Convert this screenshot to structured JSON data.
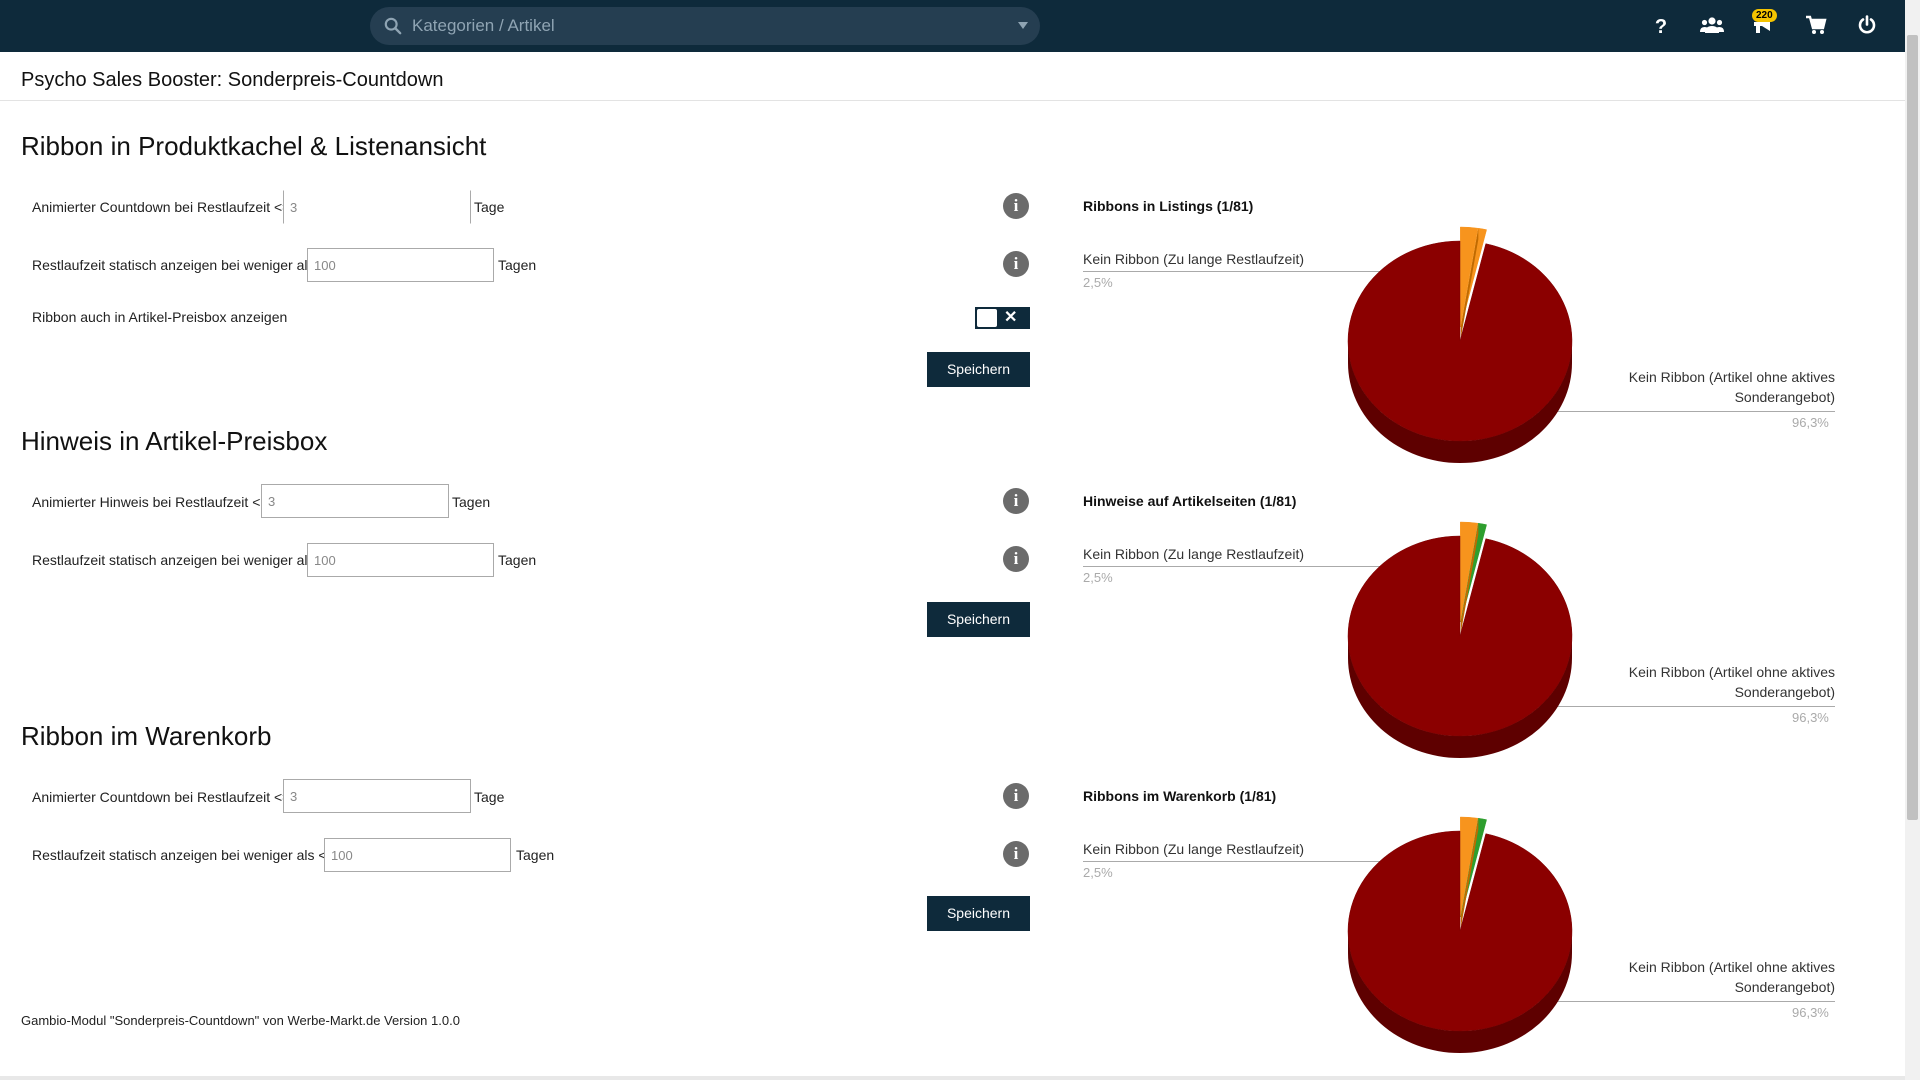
{
  "topbar": {
    "search_placeholder": "Kategorien / Artikel",
    "help_icon": "question-icon",
    "users_icon": "users-icon",
    "notifications_icon": "megaphone-icon",
    "notifications_count": "220",
    "cart_icon": "cart-icon",
    "power_icon": "power-icon"
  },
  "page": {
    "title": "Psycho Sales Booster: Sonderpreis-Countdown"
  },
  "sections": [
    {
      "title": "Ribbon in Produktkachel & Listenansicht",
      "row1_label": "Animierter Countdown bei Restlaufzeit <=",
      "row1_value": "3",
      "row1_unit": "Tage",
      "row2_label": "Restlaufzeit statisch anzeigen bei weniger als",
      "row2_value": "100",
      "row2_unit": "Tagen",
      "toggle_label": "Ribbon auch in Artikel-Preisbox anzeigen",
      "toggle_state": "off",
      "save": "Speichern"
    },
    {
      "title": "Hinweis in Artikel-Preisbox",
      "row1_label": "Animierter Hinweis bei Restlaufzeit <=",
      "row1_value": "3",
      "row1_unit": "Tagen",
      "row2_label": "Restlaufzeit statisch anzeigen bei weniger als",
      "row2_value": "100",
      "row2_unit": "Tagen",
      "save": "Speichern"
    },
    {
      "title": "Ribbon im Warenkorb",
      "row1_label": "Animierter Countdown bei Restlaufzeit <=",
      "row1_value": "3",
      "row1_unit": "Tage",
      "row2_label": "Restlaufzeit statisch anzeigen bei weniger als <=",
      "row2_value": "100",
      "row2_unit": "Tagen",
      "save": "Speichern"
    }
  ],
  "chart_data": [
    {
      "type": "pie",
      "title": "Ribbons in Listings (1/81)",
      "slices": [
        {
          "label": "Kein Ribbon (Zu lange Restlaufzeit)",
          "pct_text": "2,5%",
          "value": 2.5,
          "color": "#f7941d"
        },
        {
          "label": "",
          "pct_text": "",
          "value": 1.2,
          "color": "#f7941d"
        },
        {
          "label": "Kein Ribbon (Artikel ohne aktives Sonderangebot)",
          "pct_text": "96,3%",
          "value": 96.3,
          "color": "#8b0000"
        }
      ]
    },
    {
      "type": "pie",
      "title": "Hinweise auf Artikelseiten (1/81)",
      "slices": [
        {
          "label": "Kein Ribbon (Zu lange Restlaufzeit)",
          "pct_text": "2,5%",
          "value": 2.5,
          "color": "#f7941d"
        },
        {
          "label": "",
          "pct_text": "",
          "value": 1.2,
          "color": "#2e9e2e"
        },
        {
          "label": "Kein Ribbon (Artikel ohne aktives Sonderangebot)",
          "pct_text": "96,3%",
          "value": 96.3,
          "color": "#8b0000"
        }
      ]
    },
    {
      "type": "pie",
      "title": "Ribbons im Warenkorb (1/81)",
      "slices": [
        {
          "label": "Kein Ribbon (Zu lange Restlaufzeit)",
          "pct_text": "2,5%",
          "value": 2.5,
          "color": "#f7941d"
        },
        {
          "label": "",
          "pct_text": "",
          "value": 1.2,
          "color": "#2e9e2e"
        },
        {
          "label": "Kein Ribbon (Artikel ohne aktives Sonderangebot)",
          "pct_text": "96,3%",
          "value": 96.3,
          "color": "#8b0000"
        }
      ]
    }
  ],
  "footer": "Gambio-Modul \"Sonderpreis-Countdown\" von Werbe-Markt.de Version 1.0.0",
  "colors": {
    "topbar": "#0e2a3b",
    "button": "#0e2a3b",
    "pie_main": "#8b0000",
    "pie_orange": "#f7941d",
    "pie_green": "#2e9e2e"
  }
}
